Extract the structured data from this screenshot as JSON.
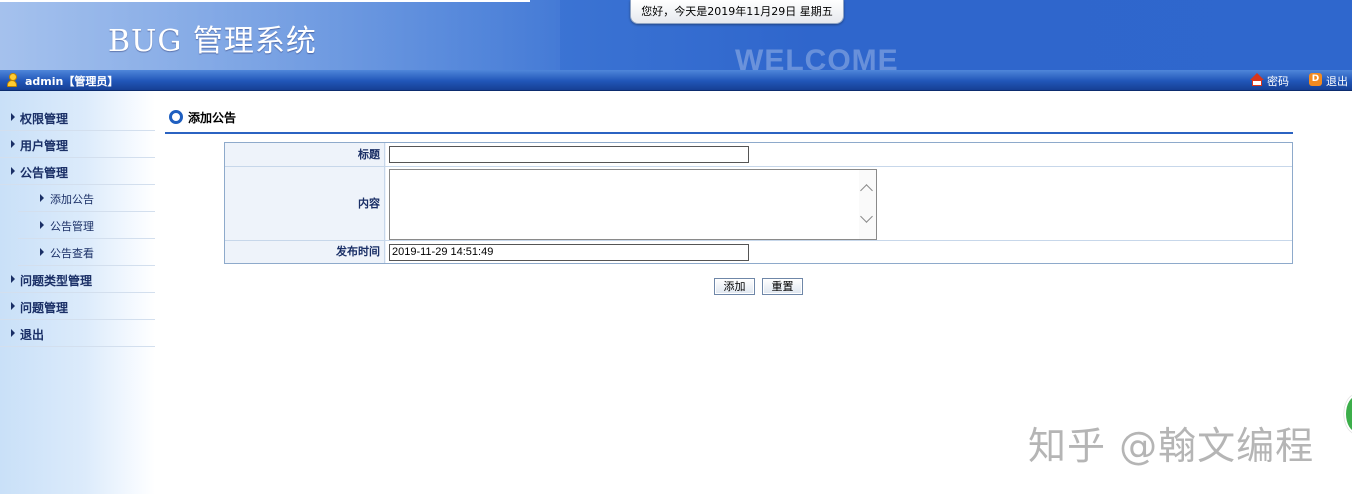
{
  "header": {
    "app_title": "BUG 管理系统",
    "date_text": "您好，今天是2019年11月29日 星期五",
    "welcome_text": "WELCOME"
  },
  "userbar": {
    "username": "admin【管理员】",
    "password_link": "密码",
    "logout_link": "退出",
    "icons": [
      "user-icon",
      "home-icon",
      "exit-icon"
    ]
  },
  "sidebar": {
    "items": [
      {
        "label": "权限管理"
      },
      {
        "label": "用户管理"
      },
      {
        "label": "公告管理"
      },
      {
        "label": "问题类型管理"
      },
      {
        "label": "问题管理"
      },
      {
        "label": "退出"
      }
    ],
    "submenu": [
      {
        "label": "添加公告"
      },
      {
        "label": "公告管理"
      },
      {
        "label": "公告查看"
      }
    ]
  },
  "main": {
    "section_title": "添加公告",
    "form": {
      "title_label": "标题",
      "title_value": "",
      "content_label": "内容",
      "content_value": "",
      "time_label": "发布时间",
      "time_value": "2019-11-29 14:51:49"
    },
    "buttons": {
      "add": "添加",
      "reset": "重置"
    }
  },
  "watermark": "知乎 @翰文编程",
  "colors": {
    "header_blue": "#3f78d6",
    "userbar_blue": "#2156b8",
    "accent_line": "#2b63c2",
    "menu_text": "#1a2f66"
  }
}
